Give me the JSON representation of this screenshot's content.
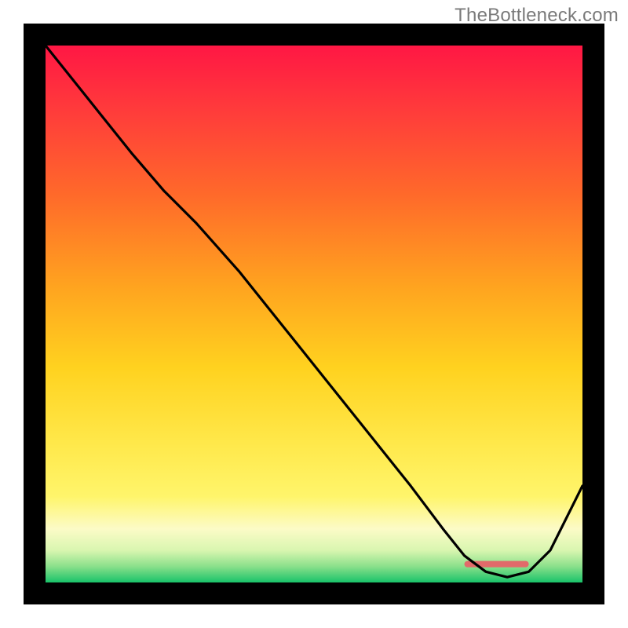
{
  "watermark": "TheBottleneck.com",
  "chart_data": {
    "type": "line",
    "title": "",
    "xlabel": "",
    "ylabel": "",
    "xlim": [
      0,
      100
    ],
    "ylim": [
      0,
      100
    ],
    "grid": false,
    "legend": false,
    "gradient_stops": [
      {
        "pct": 0,
        "color": "#ff1744"
      },
      {
        "pct": 12,
        "color": "#ff3b3b"
      },
      {
        "pct": 28,
        "color": "#ff6a2a"
      },
      {
        "pct": 45,
        "color": "#ffa41f"
      },
      {
        "pct": 60,
        "color": "#ffd21f"
      },
      {
        "pct": 74,
        "color": "#ffe84a"
      },
      {
        "pct": 84,
        "color": "#fff56b"
      },
      {
        "pct": 90,
        "color": "#fcfbc7"
      },
      {
        "pct": 94,
        "color": "#d9f6b0"
      },
      {
        "pct": 97,
        "color": "#8be08b"
      },
      {
        "pct": 100,
        "color": "#19c36a"
      }
    ],
    "series": [
      {
        "name": "curve",
        "x": [
          0,
          8,
          16,
          22,
          28,
          36,
          44,
          52,
          60,
          68,
          74,
          78,
          82,
          86,
          90,
          94,
          100
        ],
        "y": [
          100,
          90,
          80,
          73,
          67,
          58,
          48,
          38,
          28,
          18,
          10,
          5,
          2,
          1,
          2,
          6,
          18
        ]
      }
    ],
    "flat_band": {
      "y_from": 0,
      "y_to": 4,
      "x_from": 78,
      "x_to": 90,
      "color": "#e26a6a"
    }
  }
}
